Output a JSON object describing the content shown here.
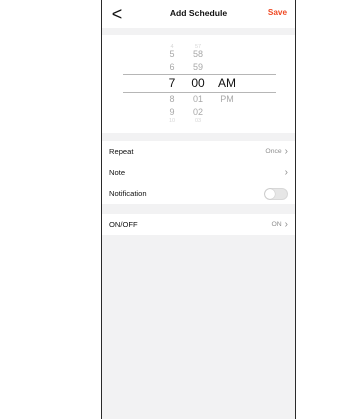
{
  "header": {
    "back_label": "<",
    "title": "Add Schedule",
    "save_label": "Save",
    "save_color": "#f04a24"
  },
  "picker": {
    "hours": [
      "4",
      "5",
      "6",
      "7",
      "8",
      "9",
      "10"
    ],
    "minutes": [
      "57",
      "58",
      "59",
      "00",
      "01",
      "02",
      "03"
    ],
    "meridiem": [
      "AM",
      "PM"
    ],
    "selected": {
      "hour": "7",
      "minute": "00",
      "meridiem": "AM"
    }
  },
  "settings": {
    "repeat": {
      "label": "Repeat",
      "value": "Once"
    },
    "note": {
      "label": "Note",
      "value": ""
    },
    "notification": {
      "label": "Notification",
      "enabled": false
    },
    "onoff": {
      "label": "ON/OFF",
      "value": "ON"
    }
  },
  "icons": {
    "back": "chevron-left-icon",
    "row_arrow": "chevron-right-icon"
  }
}
